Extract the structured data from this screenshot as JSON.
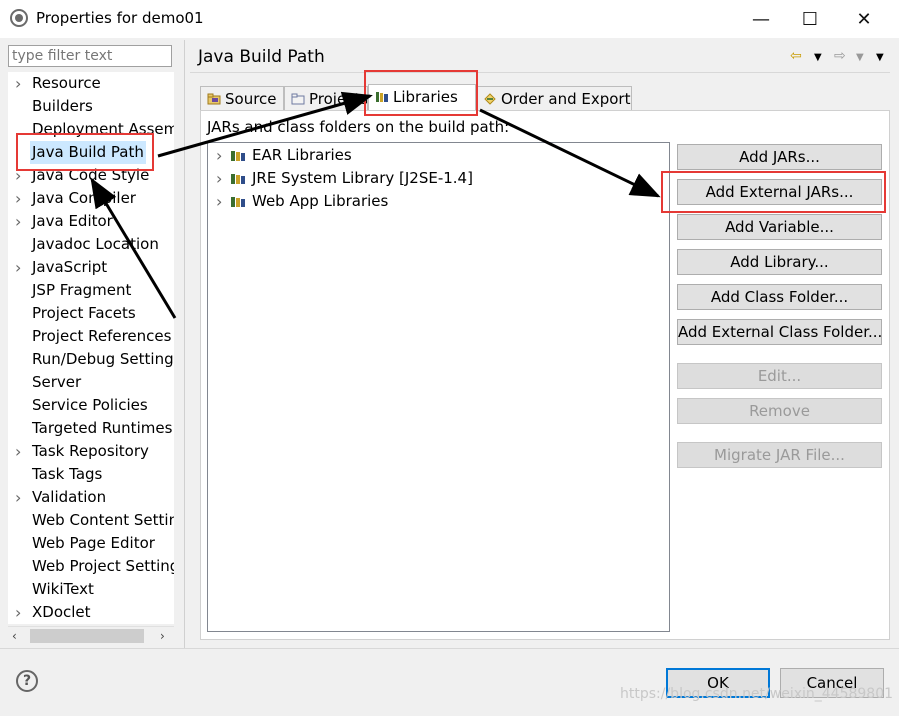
{
  "window": {
    "title": "Properties for demo01",
    "minimize": "—",
    "maximize": "☐",
    "close": "✕"
  },
  "filter": {
    "placeholder": "type filter text",
    "value": ""
  },
  "tree": {
    "items": [
      {
        "label": "Resource",
        "expandable": true
      },
      {
        "label": "Builders",
        "expandable": false
      },
      {
        "label": "Deployment Assem",
        "expandable": false
      },
      {
        "label": "Java Build Path",
        "expandable": false,
        "selected": true
      },
      {
        "label": "Java Code Style",
        "expandable": true
      },
      {
        "label": "Java Compiler",
        "expandable": true
      },
      {
        "label": "Java Editor",
        "expandable": true
      },
      {
        "label": "Javadoc Location",
        "expandable": false
      },
      {
        "label": "JavaScript",
        "expandable": true
      },
      {
        "label": "JSP Fragment",
        "expandable": false
      },
      {
        "label": "Project Facets",
        "expandable": false
      },
      {
        "label": "Project References",
        "expandable": false
      },
      {
        "label": "Run/Debug Settings",
        "expandable": false
      },
      {
        "label": "Server",
        "expandable": false
      },
      {
        "label": "Service Policies",
        "expandable": false
      },
      {
        "label": "Targeted Runtimes",
        "expandable": false
      },
      {
        "label": "Task Repository",
        "expandable": true
      },
      {
        "label": "Task Tags",
        "expandable": false
      },
      {
        "label": "Validation",
        "expandable": true
      },
      {
        "label": "Web Content Settin",
        "expandable": false
      },
      {
        "label": "Web Page Editor",
        "expandable": false
      },
      {
        "label": "Web Project Setting",
        "expandable": false
      },
      {
        "label": "WikiText",
        "expandable": false
      },
      {
        "label": "XDoclet",
        "expandable": true
      }
    ]
  },
  "page": {
    "title": "Java Build Path",
    "tabs": [
      {
        "label": "Source"
      },
      {
        "label": "Projects"
      },
      {
        "label": "Libraries",
        "active": true
      },
      {
        "label": "Order and Export"
      }
    ],
    "description": "JARs and class folders on the build path:",
    "libraries": [
      {
        "label": "EAR Libraries"
      },
      {
        "label": "JRE System Library [J2SE-1.4]"
      },
      {
        "label": "Web App Libraries"
      }
    ],
    "buttons": [
      {
        "label": "Add JARs...",
        "enabled": true
      },
      {
        "label": "Add External JARs...",
        "enabled": true
      },
      {
        "label": "Add Variable...",
        "enabled": true
      },
      {
        "label": "Add Library...",
        "enabled": true
      },
      {
        "label": "Add Class Folder...",
        "enabled": true
      },
      {
        "label": "Add External Class Folder...",
        "enabled": true
      },
      {
        "label": "Edit...",
        "enabled": false
      },
      {
        "label": "Remove",
        "enabled": false
      },
      {
        "label": "Migrate JAR File...",
        "enabled": false
      }
    ]
  },
  "footer": {
    "help": "?",
    "ok": "OK",
    "cancel": "Cancel",
    "watermark": "https://blog.csdn.net/weixin_44589801"
  },
  "colors": {
    "highlight": "#e53935",
    "selection": "#cce8ff",
    "default_button_border": "#0078d7"
  }
}
